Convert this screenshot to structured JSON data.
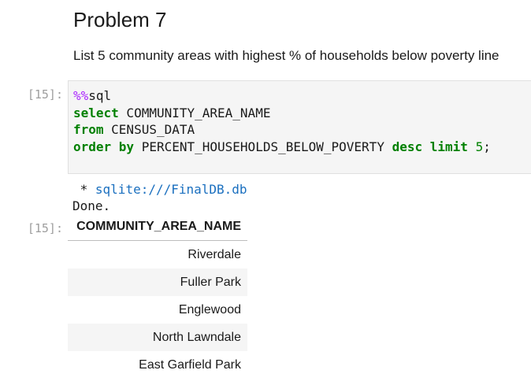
{
  "markdown": {
    "heading": "Problem 7",
    "text": "List 5 community areas with highest % of households below poverty line"
  },
  "cell": {
    "in_prompt": "[15]:",
    "out_prompt": "[15]:",
    "code": {
      "line1_magic": "%%",
      "line1_rest": "sql",
      "line2_kw": "select",
      "line2_rest": " COMMUNITY_AREA_NAME",
      "line3_kw": "from",
      "line3_rest": " CENSUS_DATA",
      "line4_kw1": "order by",
      "line4_mid": " PERCENT_HOUSEHOLDS_BELOW_POVERTY ",
      "line4_kw2": "desc",
      "line4_space": " ",
      "line4_kw3": "limit",
      "line4_space2": " ",
      "line4_num": "5",
      "line4_punct": ";"
    },
    "output": {
      "conn_prefix": " * ",
      "conn_string": "sqlite:///FinalDB.db",
      "done": "Done."
    },
    "table": {
      "header": "COMMUNITY_AREA_NAME",
      "rows": [
        "Riverdale",
        "Fuller Park",
        "Englewood",
        "North Lawndale",
        "East Garfield Park"
      ]
    }
  },
  "colors": {
    "keyword": "#008000",
    "magic": "#aa22ff",
    "link": "#1a6fbf",
    "prompt": "#9e9e9e",
    "cell_bg": "#f5f5f5"
  }
}
